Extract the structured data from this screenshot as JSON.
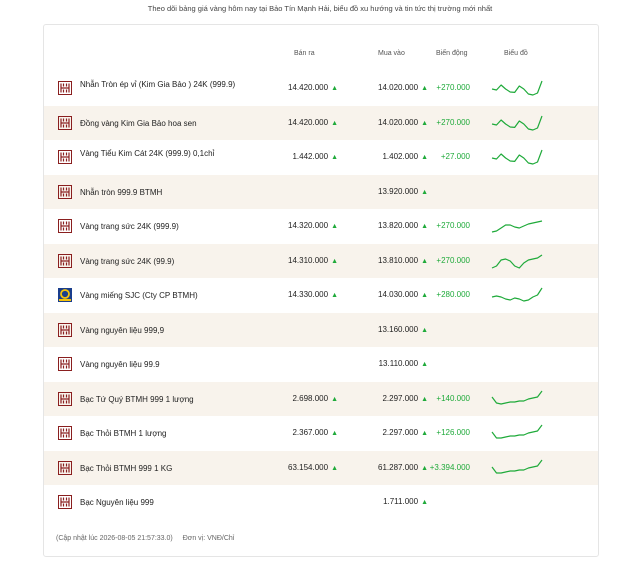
{
  "intro": "Theo dõi bảng giá vàng hôm nay tại Bảo Tín Mạnh Hải, biểu đồ xu hướng và tin tức thị trường mới nhất",
  "columns": {
    "sell": "Bán ra",
    "buy": "Mua vào",
    "change": "Biến động",
    "chart": "Biểu đồ"
  },
  "colors": {
    "up": "#1faa3a",
    "brand": "#8a1f1f",
    "row_alt": "#f8f3ec"
  },
  "rows": [
    {
      "logo": "btmh-logo",
      "name": "Nhẫn Tròn ép vỉ (Kim Gia Bảo ) 24K (999.9)",
      "sell": "14.420.000",
      "buy": "14.020.000",
      "change": "+270.000",
      "trend": [
        0.55,
        0.6,
        0.35,
        0.55,
        0.7,
        0.72,
        0.4,
        0.55,
        0.8,
        0.85,
        0.75,
        0.15
      ]
    },
    {
      "logo": "btmh-logo",
      "name": "Đồng vàng Kim Gia Bảo hoa sen",
      "sell": "14.420.000",
      "buy": "14.020.000",
      "change": "+270.000",
      "trend": [
        0.55,
        0.6,
        0.35,
        0.55,
        0.7,
        0.72,
        0.4,
        0.55,
        0.8,
        0.85,
        0.75,
        0.15
      ]
    },
    {
      "logo": "btmh-logo",
      "name": "Vàng Tiểu Kim Cát 24K (999.9) 0,1chỉ",
      "sell": "1.442.000",
      "buy": "1.402.000",
      "change": "+27.000",
      "trend": [
        0.55,
        0.6,
        0.35,
        0.55,
        0.7,
        0.72,
        0.4,
        0.55,
        0.8,
        0.85,
        0.75,
        0.15
      ]
    },
    {
      "logo": "btmh-logo",
      "name": "Nhẫn tròn 999.9 BTMH",
      "sell": "",
      "buy": "13.920.000",
      "change": "",
      "trend": []
    },
    {
      "logo": "btmh-logo",
      "name": "Vàng trang sức 24K (999.9)",
      "sell": "14.320.000",
      "buy": "13.820.000",
      "change": "+270.000",
      "trend": [
        0.8,
        0.75,
        0.6,
        0.45,
        0.45,
        0.55,
        0.6,
        0.5,
        0.4,
        0.35,
        0.3,
        0.25
      ]
    },
    {
      "logo": "btmh-logo",
      "name": "Vàng trang sức 24K (99.9)",
      "sell": "14.310.000",
      "buy": "13.810.000",
      "change": "+270.000",
      "trend": [
        0.85,
        0.75,
        0.45,
        0.4,
        0.5,
        0.75,
        0.85,
        0.6,
        0.45,
        0.4,
        0.35,
        0.2
      ]
    },
    {
      "logo": "sjc-logo",
      "name": "Vàng miếng SJC (Cty CP BTMH)",
      "sell": "14.330.000",
      "buy": "14.030.000",
      "change": "+280.000",
      "trend": [
        0.6,
        0.55,
        0.6,
        0.7,
        0.75,
        0.65,
        0.7,
        0.8,
        0.75,
        0.6,
        0.5,
        0.15
      ]
    },
    {
      "logo": "btmh-logo",
      "name": "Vàng nguyên liệu 999,9",
      "sell": "",
      "buy": "13.160.000",
      "change": "",
      "trend": []
    },
    {
      "logo": "btmh-logo",
      "name": "Vàng nguyên liệu 99.9",
      "sell": "",
      "buy": "13.110.000",
      "change": "",
      "trend": []
    },
    {
      "logo": "btmh-logo",
      "name": "Bạc Tứ Quý BTMH 999 1 lượng",
      "sell": "2.698.000",
      "buy": "2.297.000",
      "change": "+140.000",
      "trend": [
        0.4,
        0.7,
        0.75,
        0.7,
        0.65,
        0.65,
        0.6,
        0.6,
        0.5,
        0.45,
        0.4,
        0.1
      ]
    },
    {
      "logo": "btmh-logo",
      "name": "Bạc Thỏi BTMH 1 lượng",
      "sell": "2.367.000",
      "buy": "2.297.000",
      "change": "+126.000",
      "trend": [
        0.45,
        0.75,
        0.75,
        0.7,
        0.65,
        0.65,
        0.6,
        0.6,
        0.5,
        0.45,
        0.4,
        0.1
      ]
    },
    {
      "logo": "btmh-logo",
      "name": "Bạc Thỏi BTMH 999 1 KG",
      "sell": "63.154.000",
      "buy": "61.287.000",
      "change": "+3.394.000",
      "trend": [
        0.45,
        0.75,
        0.75,
        0.7,
        0.65,
        0.65,
        0.6,
        0.6,
        0.5,
        0.45,
        0.4,
        0.1
      ]
    },
    {
      "logo": "btmh-logo",
      "name": "Bạc Nguyên liệu 999",
      "sell": "",
      "buy": "1.711.000",
      "change": "",
      "trend": []
    }
  ],
  "footer": {
    "updated": "(Cập nhật lúc 2026-08-05 21:57:33.0)",
    "unit": "Đơn vị: VNĐ/Chỉ"
  }
}
